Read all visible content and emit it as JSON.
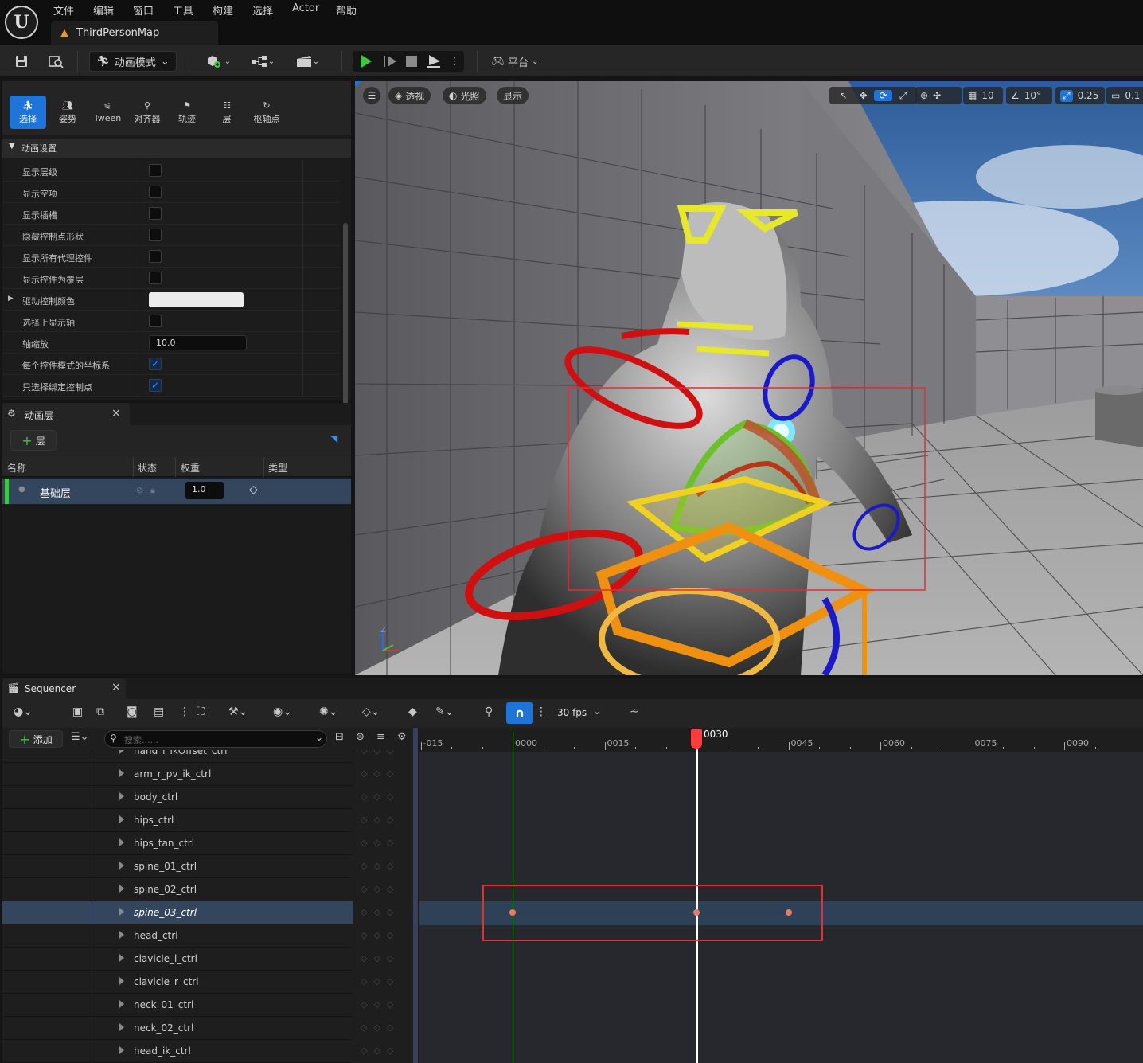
{
  "menu": [
    "文件",
    "编辑",
    "窗口",
    "工具",
    "构建",
    "选择",
    "Actor",
    "帮助"
  ],
  "map_tab": "ThirdPersonMap",
  "toolbar": {
    "mode_label": "动画模式",
    "platform_label": "平台"
  },
  "modes": [
    "选择",
    "姿势",
    "Tween",
    "对齐器",
    "轨迹",
    "层",
    "枢轴点"
  ],
  "anim_settings": {
    "header": "动画设置",
    "rows": [
      {
        "label": "显示层级",
        "checked": false
      },
      {
        "label": "显示空项",
        "checked": false
      },
      {
        "label": "显示插槽",
        "checked": false
      },
      {
        "label": "隐藏控制点形状",
        "checked": false
      },
      {
        "label": "显示所有代理控件",
        "checked": false
      },
      {
        "label": "显示控件为覆层",
        "checked": false
      },
      {
        "label": "驱动控制颜色",
        "checked": null
      },
      {
        "label": "选择上显示轴",
        "checked": false
      },
      {
        "label": "轴缩放",
        "checked": null
      },
      {
        "label": "每个控件模式的坐标系",
        "checked": true
      },
      {
        "label": "只选择绑定控制点",
        "checked": true
      }
    ],
    "axis_scale_value": "10.0",
    "check_mark": "✓"
  },
  "anim_layers": {
    "tab": "动画层",
    "close": "×",
    "add_layer": "层",
    "columns": [
      "名称",
      "状态",
      "权重",
      "类型"
    ],
    "layer_name": "基础层",
    "layer_weight": "1.0"
  },
  "viewport": {
    "menu_btn": "☰",
    "perspective": "透视",
    "lit": "光照",
    "show": "显示",
    "grid_snap": "10",
    "rot_snap": "10°",
    "scale_snap": "0.25",
    "cam_speed": "0.1",
    "axis_z": "Z"
  },
  "sequencer": {
    "tab": "Sequencer",
    "close": "×",
    "add": "添加",
    "search_placeholder": "搜索......",
    "fps": "30 fps",
    "current_frame": "0030",
    "ruler": [
      "-015",
      "0000",
      "0015",
      "0030",
      "0045",
      "0060",
      "0075",
      "0090"
    ],
    "tracks": [
      "hand_l_ikOffset_ctrl",
      "arm_r_pv_ik_ctrl",
      "body_ctrl",
      "hips_ctrl",
      "hips_tan_ctrl",
      "spine_01_ctrl",
      "spine_02_ctrl",
      "spine_03_ctrl",
      "head_ctrl",
      "clavicle_l_ctrl",
      "clavicle_r_ctrl",
      "neck_01_ctrl",
      "neck_02_ctrl",
      "head_ik_ctrl"
    ],
    "selected_track": "spine_03_ctrl",
    "keyframes": [
      0,
      30,
      45
    ]
  },
  "colors": {
    "accent": "#1e74d8",
    "playhead": "#ff3b3b",
    "play_green": "#3cc93c",
    "highlight_box": "#e03030"
  }
}
